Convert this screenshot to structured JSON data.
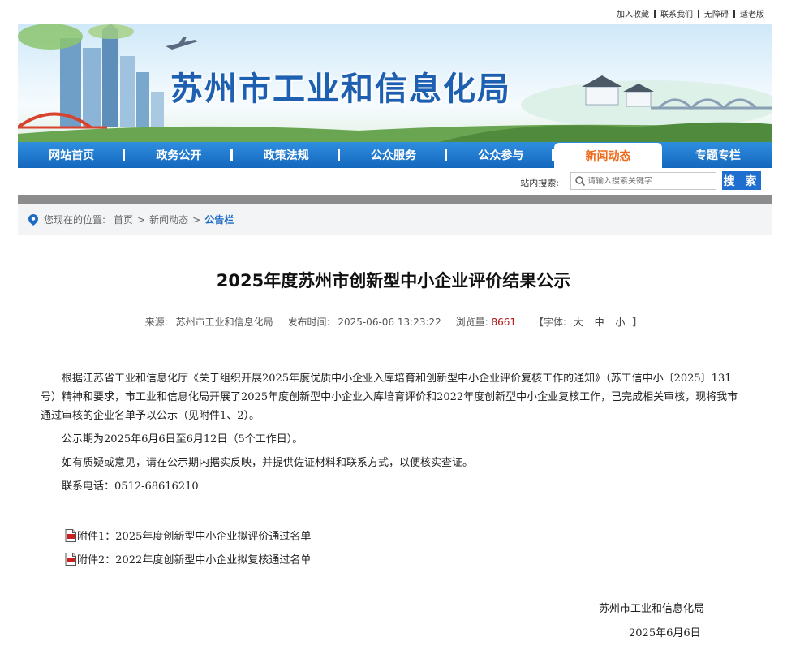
{
  "toplinks": [
    "加入收藏",
    "联系我们",
    "无障碍",
    "适老版"
  ],
  "banner": {
    "title": "苏州市工业和信息化局"
  },
  "nav": [
    {
      "label": "网站首页"
    },
    {
      "label": "政务公开"
    },
    {
      "label": "政策法规"
    },
    {
      "label": "公众服务"
    },
    {
      "label": "公众参与"
    },
    {
      "label": "新闻动态",
      "active": true
    },
    {
      "label": "专题专栏"
    }
  ],
  "search": {
    "label": "站内搜索:",
    "placeholder": "请输入搜索关键字",
    "button": "搜 索"
  },
  "breadcrumb": {
    "prefix": "您现在的位置:",
    "items": [
      "首页",
      "新闻动态"
    ],
    "current": "公告栏"
  },
  "article": {
    "title": "2025年度苏州市创新型中小企业评价结果公示",
    "meta": {
      "source_label": "来源:",
      "source": "苏州市工业和信息化局",
      "time_label": "发布时间:",
      "time": "2025-06-06 13:23:22",
      "views_label": "浏览量:",
      "views": "8661",
      "font_label": "【字体:",
      "font_large": "大",
      "font_medium": "中",
      "font_small": "小",
      "font_end": "】"
    },
    "paragraphs": [
      "根据江苏省工业和信息化厅《关于组织开展2025年度优质中小企业入库培育和创新型中小企业评价复核工作的通知》（苏工信中小〔2025〕131号）精神和要求，市工业和信息化局开展了2025年度创新型中小企业入库培育评价和2022年度创新型中小企业复核工作，已完成相关审核，现将我市通过审核的企业名单予以公示（见附件1、2）。",
      "公示期为2025年6月6日至6月12日（5个工作日）。",
      "如有质疑或意见，请在公示期内据实反映，并提供佐证材料和联系方式，以便核实查证。",
      "联系电话：0512-68616210"
    ],
    "attachments": [
      "附件1：2025年度创新型中小企业拟评价通过名单",
      "附件2：2022年度创新型中小企业拟复核通过名单"
    ],
    "signature": "苏州市工业和信息化局",
    "date": "2025年6月6日"
  },
  "colors": {
    "nav_blue": "#1a73c8",
    "active_orange": "#ef6a1b",
    "link_blue": "#1e6bc4",
    "views_red": "#b0191a"
  }
}
